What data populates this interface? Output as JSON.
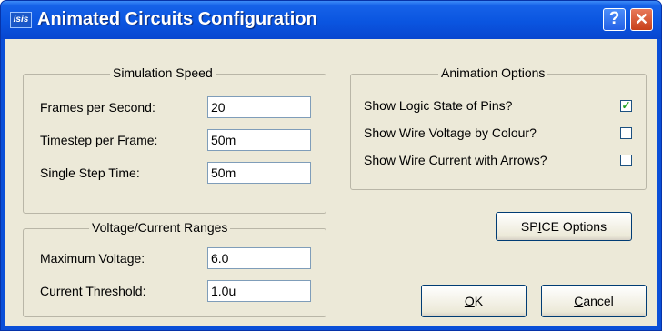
{
  "window": {
    "title": "Animated Circuits Configuration",
    "app_icon_text": "isis",
    "help_glyph": "?",
    "close_glyph": "✕"
  },
  "simulation_speed": {
    "legend": "Simulation Speed",
    "fields": [
      {
        "label": "Frames per Second:",
        "value": "20"
      },
      {
        "label": "Timestep per Frame:",
        "value": "50m"
      },
      {
        "label": "Single Step Time:",
        "value": "50m"
      }
    ]
  },
  "voltage_current": {
    "legend": "Voltage/Current Ranges",
    "fields": [
      {
        "label": "Maximum Voltage:",
        "value": "6.0"
      },
      {
        "label": "Current Threshold:",
        "value": "1.0u"
      }
    ]
  },
  "animation_options": {
    "legend": "Animation Options",
    "options": [
      {
        "label": "Show Logic State of Pins?",
        "checked": true
      },
      {
        "label": "Show Wire Voltage by Colour?",
        "checked": false
      },
      {
        "label": "Show Wire Current with Arrows?",
        "checked": false
      }
    ]
  },
  "buttons": {
    "spice_pre": "SP",
    "spice_mnemonic": "I",
    "spice_post": "CE Options",
    "ok_mnemonic": "O",
    "ok_post": "K",
    "cancel_mnemonic": "C",
    "cancel_post": "ancel"
  },
  "colors": {
    "titlebar": "#0a55e0",
    "dialog_background": "#ece9d8",
    "close_button": "#c8401a",
    "check_mark": "#21a121"
  }
}
